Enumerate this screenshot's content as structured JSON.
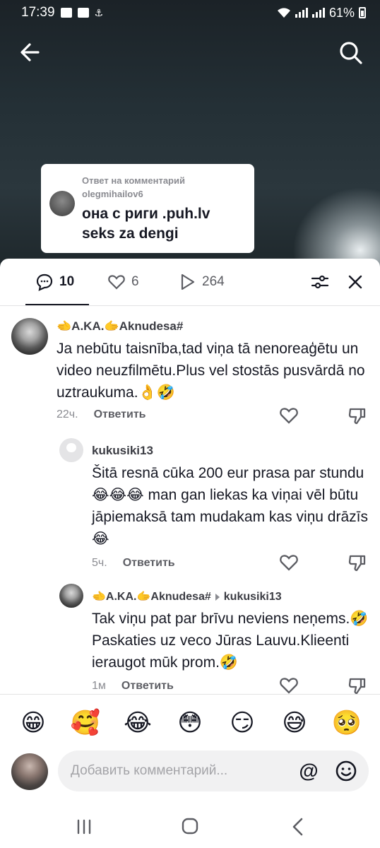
{
  "status_bar": {
    "time": "17:39",
    "battery": "61%"
  },
  "video": {
    "reply_header": "Ответ на комментарий",
    "reply_user": "olegmihailov6",
    "reply_text_line1": "она с риги .puh.lv",
    "reply_text_line2": "seks za dengi"
  },
  "stats": {
    "comments": "10",
    "likes": "6",
    "views": "264"
  },
  "comments": [
    {
      "user_flag1": "🫲",
      "user_part1": "A.KA.",
      "user_flag2": "🫱",
      "user_part2": "Aknudesa#",
      "text": "Ja nebūtu taisnība,tad viņa tā nenoreaģētu un video neuzfilmētu.Plus vel stostās pusvārdā no uztraukuma.👌🤣",
      "time": "22ч.",
      "reply_label": "Ответить"
    },
    {
      "user": "kukusiki13",
      "text": "Šitā resnā cūka 200 eur prasa par stundu😂😂😂 man gan liekas ka viņai vēl būtu jāpiemaksā tam mudakam kas viņu drāzīs😂",
      "time": "5ч.",
      "reply_label": "Ответить"
    },
    {
      "user_flag1": "🫲",
      "user_part1": "A.KA.",
      "user_flag2": "🫱",
      "user_part2": "Aknudesa#",
      "reply_to": "kukusiki13",
      "text": "Tak viņu pat par brīvu neviens neņems.🤣Paskaties uz veco Jūras Lauvu.Klieenti ieraugot mūk prom.🤣",
      "time": "1м",
      "reply_label": "Ответить"
    }
  ],
  "emoji_bar": [
    "😁",
    "🥰",
    "😂",
    "😳",
    "😏",
    "😅",
    "🥺"
  ],
  "input": {
    "placeholder": "Добавить комментарий...",
    "at_symbol": "@"
  }
}
